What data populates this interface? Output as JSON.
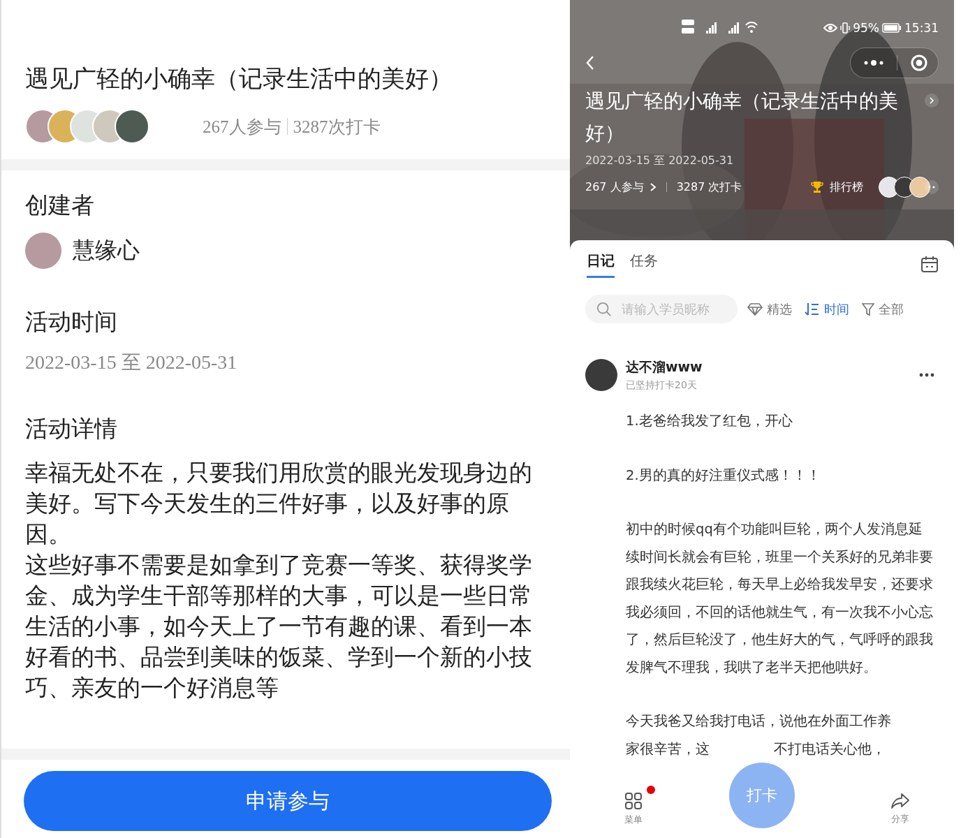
{
  "left": {
    "title": "遇见广轻的小确幸（记录生活中的美好）",
    "participants": "267人参与",
    "checkins": "3287次打卡",
    "creator_label": "创建者",
    "creator_name": "慧缘心",
    "time_label": "活动时间",
    "time_value": "2022-03-15 至 2022-05-31",
    "detail_label": "活动详情",
    "detail_paragraphs": [
      "幸福无处不在，只要我们用欣赏的眼光发现身边的美好。写下今天发生的三件好事，以及好事的原因。",
      "这些好事不需要是如拿到了竞赛一等奖、获得奖学金、成为学生干部等那样的大事，可以是一些日常生活的小事，如今天上了一节有趣的课、看到一本好看的书、品尝到美味的饭菜、学到一个新的小技巧、亲友的一个好消息等"
    ],
    "apply_button": "申请参与"
  },
  "right": {
    "status_bar": {
      "battery": "95%",
      "time": "15:31"
    },
    "title": "遇见广轻的小确幸（记录生活中的美好）",
    "dates": "2022-03-15 至 2022-05-31",
    "participants": "267 人参与",
    "checkins": "3287 次打卡",
    "ranking": "排行榜",
    "tabs": [
      {
        "label": "日记",
        "selected": true
      },
      {
        "label": "任务",
        "selected": false
      }
    ],
    "search": {
      "placeholder": "请输入学员昵称"
    },
    "filters": [
      {
        "label": "精选",
        "kind": "featured",
        "selected": false
      },
      {
        "label": "时间",
        "kind": "sort",
        "selected": true
      },
      {
        "label": "全部",
        "kind": "filter",
        "selected": false
      }
    ],
    "post": {
      "author": "达不溜www",
      "streak": "已坚持打卡20天",
      "paragraphs": [
        "1.老爸给我发了红包，开心",
        "2.男的真的好注重仪式感！！！",
        "初中的时候qq有个功能叫巨轮，两个人发消息延续时间长就会有巨轮，班里一个关系好的兄弟非要跟我续火花巨轮，每天早上必给我发早安，还要求我必须回，不回的话他就生气，有一次我不小心忘了，然后巨轮没了，他生好大的气，气呼呼的跟我发脾气不理我，我哄了老半天把他哄好。",
        "今天我爸又给我打电话，说他在外面工作养"
      ],
      "partial_line": [
        "家很辛苦，这",
        "不打电话关心他，"
      ]
    },
    "bottom_nav": {
      "menu": "菜单",
      "menu_badge": true,
      "checkin": "打卡",
      "share": "分享"
    }
  }
}
